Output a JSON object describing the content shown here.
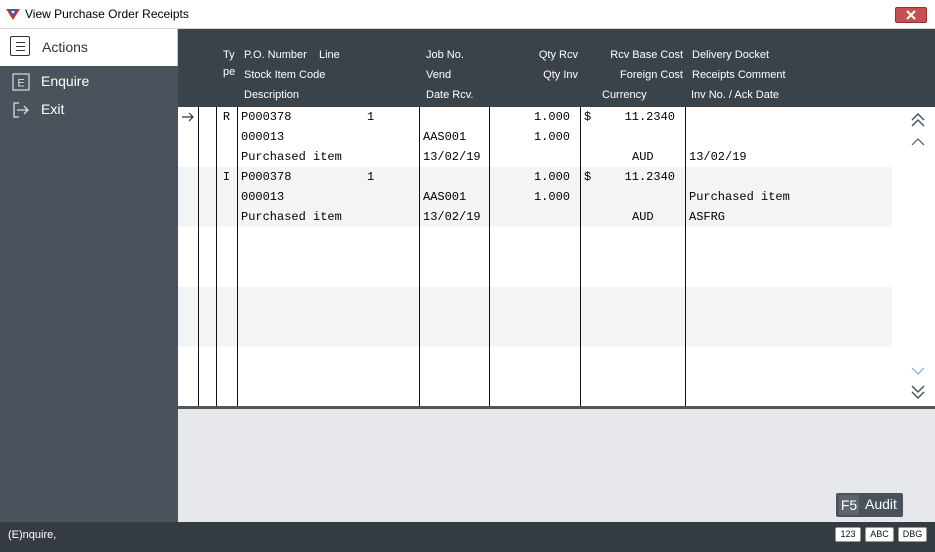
{
  "window": {
    "title": "View Purchase Order Receipts"
  },
  "sidebar": {
    "header": "Actions",
    "items": [
      {
        "key": "E",
        "label": "Enquire"
      },
      {
        "key": "",
        "label": "Exit"
      }
    ]
  },
  "columns": {
    "type_line1": "Ty",
    "type_line2": "pe",
    "po_number": "P.O. Number",
    "line": "Line",
    "stock_item_code": "Stock Item Code",
    "description": "Description",
    "job_no": "Job No.",
    "vend": "Vend",
    "date_rcv": "Date Rcv.",
    "qty_rcv": "Qty Rcv",
    "qty_inv": "Qty Inv",
    "rcv_base_cost": "Rcv Base Cost",
    "foreign_cost": "Foreign Cost",
    "currency": "Currency",
    "delivery_docket": "Delivery Docket",
    "receipts_comment": "Receipts Comment",
    "inv_no_ack_date": "Inv No. / Ack Date"
  },
  "records": [
    {
      "type": "R",
      "po_number": "P000378",
      "line": "1",
      "stock_item_code": "000013",
      "description": "Purchased item",
      "job_no": "",
      "vend": "AAS001",
      "date_rcv": "13/02/19",
      "qty_rcv": "1.000",
      "qty_inv": "1.000",
      "cost_symbol": "$",
      "rcv_base_cost": "11.2340",
      "currency": "AUD",
      "delivery_docket": "",
      "receipts_comment": "",
      "inv_no_ack_date": "13/02/19"
    },
    {
      "type": "I",
      "po_number": "P000378",
      "line": "1",
      "stock_item_code": "000013",
      "description": "Purchased item",
      "job_no": "",
      "vend": "AAS001",
      "date_rcv": "13/02/19",
      "qty_rcv": "1.000",
      "qty_inv": "1.000",
      "cost_symbol": "$",
      "rcv_base_cost": "11.2340",
      "currency": "AUD",
      "delivery_docket": "",
      "receipts_comment": "Purchased item",
      "inv_no_ack_date": "ASFRG"
    }
  ],
  "audit": {
    "key": "F5",
    "label": "Audit"
  },
  "status": {
    "message": "(E)nquire,",
    "badges": [
      "123",
      "ABC",
      "DBG"
    ]
  },
  "icons": {
    "app": "app-logo-icon",
    "close": "close-icon",
    "actions": "menu-list-icon",
    "exit": "exit-arrow-icon",
    "row_pointer": "right-arrow-icon",
    "scroll_top": "double-chevron-up-icon",
    "scroll_up": "chevron-up-icon",
    "scroll_down": "chevron-down-icon",
    "scroll_bottom": "double-chevron-down-icon"
  },
  "colors": {
    "sidebar": "#4a535b",
    "header": "#3a4349",
    "statusbar": "#343c42",
    "close_button": "#c74f4f",
    "scroll_up_active": "#4a5660",
    "scroll_down_active": "#6fb1dd"
  }
}
